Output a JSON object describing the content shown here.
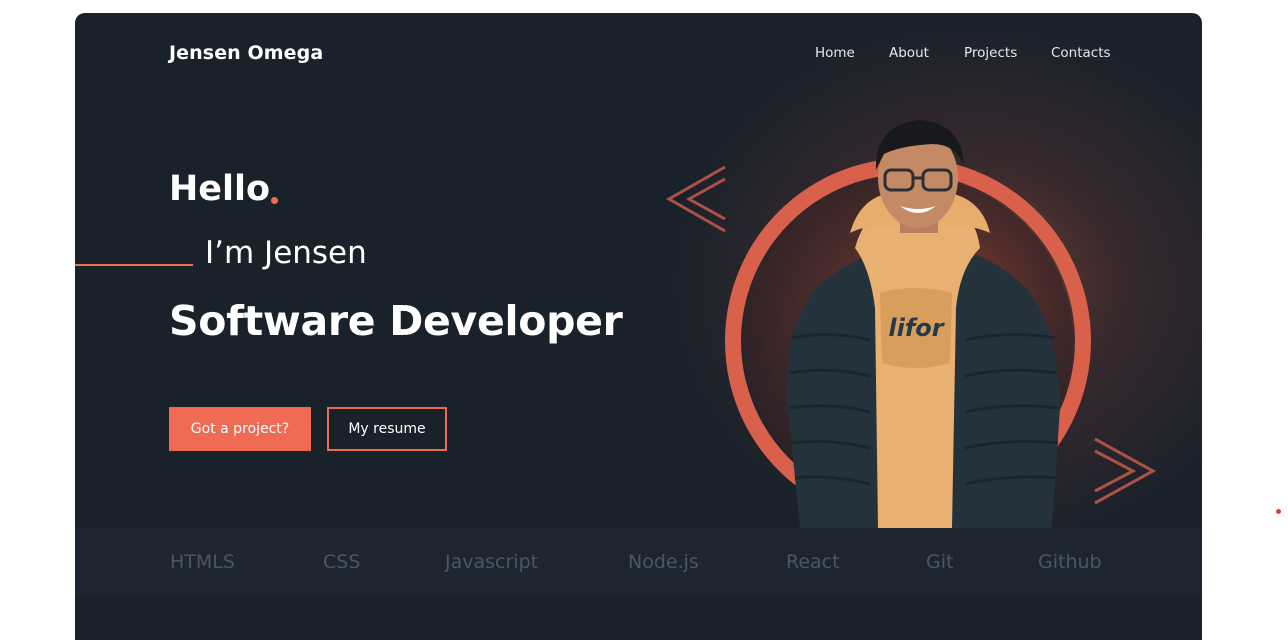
{
  "header": {
    "brand": "Jensen Omega",
    "nav": [
      "Home",
      "About",
      "Projects",
      "Contacts"
    ]
  },
  "hero": {
    "greeting": "Hello",
    "intro": "I’m Jensen",
    "role": "Software Developer",
    "primary_button": "Got a project?",
    "secondary_button": "My resume"
  },
  "skills": [
    "HTMLS",
    "CSS",
    "Javascript",
    "Node.js",
    "React",
    "Git",
    "Github"
  ],
  "colors": {
    "accent": "#f06b54",
    "background": "#19212b",
    "skills_bar": "#1c2530",
    "skill_text": "#4a5665"
  },
  "icons": {
    "left_chevron": "chevron-left-icon",
    "right_chevron": "chevron-right-icon"
  }
}
